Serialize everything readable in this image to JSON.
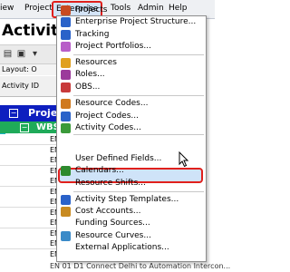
{
  "menubar": {
    "items": [
      {
        "label": "iew"
      },
      {
        "label": "Project"
      },
      {
        "label": "Enterprise"
      },
      {
        "label": "Tools"
      },
      {
        "label": "Admin"
      },
      {
        "label": "Help"
      }
    ],
    "active": "Enterprise"
  },
  "background": {
    "title": "Activiti",
    "layout_label": "Layout: O",
    "column_header": "Activity ID",
    "project_row": "Proje",
    "wbs_row": "WBS",
    "row_prefix": "EN",
    "row_count": 13,
    "bottom_partial": "EN 01 D1 Connect Delhi to Automation Intercon..."
  },
  "menu": {
    "items": [
      {
        "label": "Projects",
        "icon": "projects-icon",
        "color": "#c84a20"
      },
      {
        "label": "Enterprise Project Structure...",
        "icon": "eps-icon",
        "color": "#2a62c9"
      },
      {
        "label": "Tracking",
        "icon": "tracking-icon",
        "color": "#2a62c9"
      },
      {
        "label": "Project Portfolios...",
        "icon": "portfolio-icon",
        "color": "#b85ec8"
      },
      {
        "label": "Resources",
        "icon": "resources-icon",
        "color": "#e0a020"
      },
      {
        "label": "Roles...",
        "icon": "roles-icon",
        "color": "#9b3a9b"
      },
      {
        "label": "OBS...",
        "icon": "obs-icon",
        "color": "#c83a3a"
      },
      {
        "label": "Resource Codes...",
        "icon": "resource-codes-icon",
        "color": "#d07a20"
      },
      {
        "label": "Project Codes...",
        "icon": "project-codes-icon",
        "color": "#2a62c9"
      },
      {
        "label": "Activity Codes...",
        "icon": "activity-codes-icon",
        "color": "#3a9a3a"
      },
      {
        "label": "User Defined Fields...",
        "icon": "",
        "color": ""
      },
      {
        "label": "Calendars...",
        "icon": "calendar-icon",
        "color": "#2e8a2e"
      },
      {
        "label": "Resource Shifts...",
        "icon": "",
        "color": ""
      },
      {
        "label": "Activity Step Templates...",
        "icon": "step-templates-icon",
        "color": "#2a62c9"
      },
      {
        "label": "Cost Accounts...",
        "icon": "cost-accounts-icon",
        "color": "#c88a20"
      },
      {
        "label": "Funding Sources...",
        "icon": "",
        "color": ""
      },
      {
        "label": "Resource Curves...",
        "icon": "resource-curves-icon",
        "color": "#3a8ac8"
      },
      {
        "label": "External Applications...",
        "icon": "",
        "color": ""
      }
    ],
    "highlighted": "User Defined Fields..."
  },
  "colors": {
    "accent_highlight": "#e0201c",
    "project_band": "#0e1fbf",
    "wbs_band": "#1faa59"
  }
}
